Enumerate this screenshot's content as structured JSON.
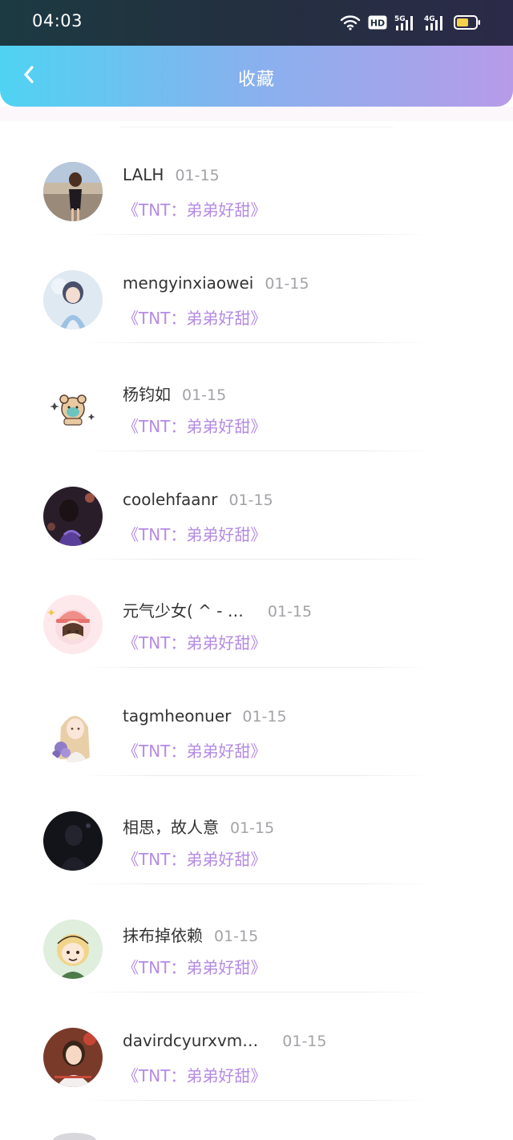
{
  "status_bar": {
    "time": "04:03",
    "icons": [
      "wifi-icon",
      "hd-icon",
      "5g-signal-icon",
      "4g-signal-icon",
      "battery-icon"
    ],
    "hd_label": "HD",
    "net_5g": "5G",
    "net_4g": "4G"
  },
  "header": {
    "title": "收藏",
    "back_icon": "chevron-left-icon"
  },
  "colors": {
    "work_title": "#b58be4",
    "name": "#333333",
    "date": "#a3a3a8",
    "header_gradient": [
      "#4fd3f3",
      "#b79be9"
    ]
  },
  "items": [
    {
      "name": "LALH",
      "date": "01-15",
      "work": "《TNT：弟弟好甜》"
    },
    {
      "name": "mengyinxiaowei",
      "date": "01-15",
      "work": "《TNT：弟弟好甜》"
    },
    {
      "name": "杨钧如",
      "date": "01-15",
      "work": "《TNT：弟弟好甜》"
    },
    {
      "name": "coolehfaanr",
      "date": "01-15",
      "work": "《TNT：弟弟好甜》"
    },
    {
      "name": "元气少女( ^  - …",
      "date": "01-15",
      "work": "《TNT：弟弟好甜》"
    },
    {
      "name": "tagmheonuer",
      "date": "01-15",
      "work": "《TNT：弟弟好甜》"
    },
    {
      "name": "相思，故人意",
      "date": "01-15",
      "work": "《TNT：弟弟好甜》"
    },
    {
      "name": "抹布掉依赖",
      "date": "01-15",
      "work": "《TNT：弟弟好甜》"
    },
    {
      "name": "davirdcyurxvm…",
      "date": "01-15",
      "work": "《TNT：弟弟好甜》"
    }
  ]
}
